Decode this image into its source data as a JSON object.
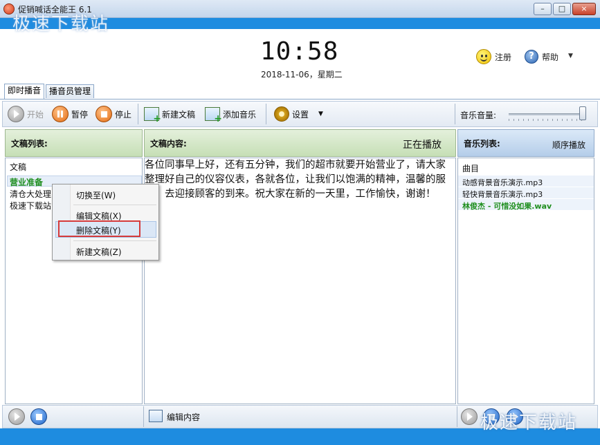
{
  "window": {
    "title": "促销喊话全能王 6.1",
    "watermark_top": "极速下载站",
    "watermark_bottom": "极速下载站",
    "minimize": "–",
    "maximize": "□",
    "close": "×"
  },
  "header": {
    "time": "10:58",
    "date": "2018-11-06，星期二",
    "register": "注册",
    "help": "帮助",
    "help_icon_glyph": "?",
    "menu_arrow": "▼"
  },
  "tabs": [
    {
      "label": "即时播音",
      "active": true
    },
    {
      "label": "播音员管理",
      "active": false
    }
  ],
  "toolbar": {
    "start": "开始",
    "pause": "暂停",
    "stop": "停止",
    "new_doc": "新建文稿",
    "add_music": "添加音乐",
    "settings": "设置",
    "settings_arrow": "▼",
    "volume_label": "音乐音量:",
    "volume_level": 1.0
  },
  "docs_panel": {
    "title": "文稿列表:",
    "column": "文稿",
    "items": [
      "营业准备",
      "清仓大处理",
      "极速下载站"
    ],
    "selected_index": 0
  },
  "content_panel": {
    "title": "文稿内容:",
    "status": "正在播放",
    "text": "各位同事早上好，还有五分钟，我们的超市就要开始营业了，请大家整理好自己的仪容仪表，各就各位，让我们以饱满的精神，温馨的服务，去迎接顾客的到来。祝大家在新的一天里，工作愉快，谢谢！"
  },
  "music_panel": {
    "title": "音乐列表:",
    "mode": "顺序播放",
    "column": "曲目",
    "songs": [
      "动感背景音乐演示.mp3",
      "轻快背景音乐演示.mp3",
      "林俊杰 - 可惜没如果.wav"
    ],
    "playing_index": 2
  },
  "context_menu": {
    "items": [
      "切换至(W)",
      "编辑文稿(X)",
      "删除文稿(Y)",
      "新建文稿(Z)"
    ],
    "highlighted_index": 2
  },
  "bottom": {
    "edit_content": "编辑内容"
  },
  "colors": {
    "accent_blue": "#1e8ce0",
    "playing_green": "#1e8e1e",
    "highlight_red": "#d63a3a"
  }
}
